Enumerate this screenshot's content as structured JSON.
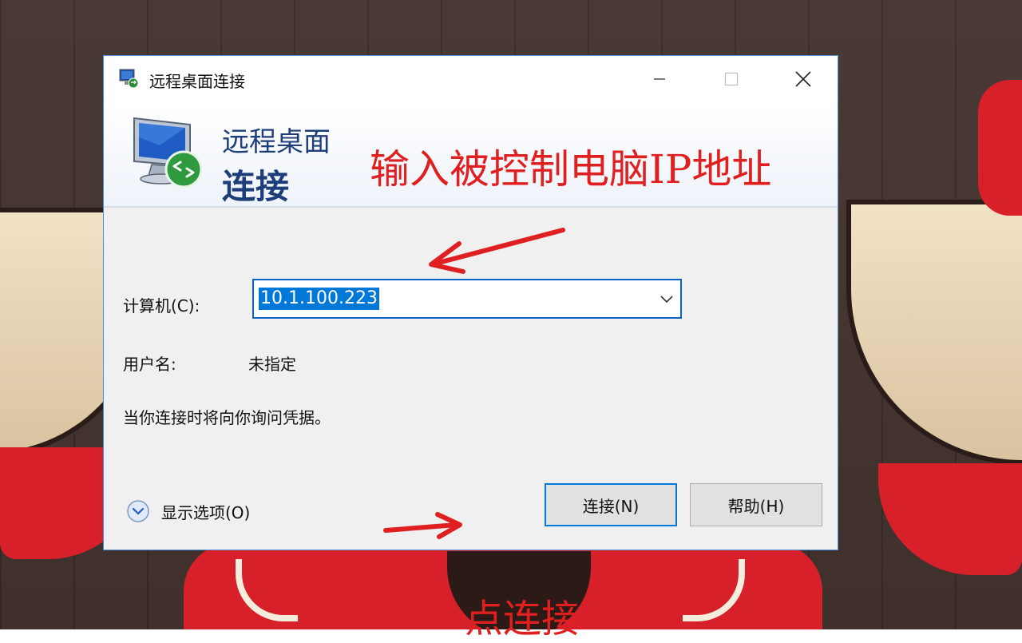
{
  "window": {
    "title": "远程桌面连接",
    "header_line1": "远程桌面",
    "header_line2": "连接"
  },
  "form": {
    "computer_label": "计算机(C):",
    "computer_value": "10.1.100.223",
    "username_label": "用户名:",
    "username_value": "未指定",
    "info_text": "当你连接时将向你询问凭据。"
  },
  "footer": {
    "options_label": "显示选项(O)",
    "connect_label": "连接(N)",
    "help_label": "帮助(H)"
  },
  "annotations": {
    "top": "输入被控制电脑IP地址",
    "bottom": "点连接"
  },
  "colors": {
    "annotation": "#e02020",
    "accent": "#0078d7",
    "header_text": "#1e3e7a"
  },
  "icons": {
    "app": "remote-desktop-icon",
    "minimize": "minimize-icon",
    "maximize": "maximize-icon",
    "close": "close-icon",
    "dropdown": "chevron-down-icon",
    "options": "expand-circle-icon"
  }
}
